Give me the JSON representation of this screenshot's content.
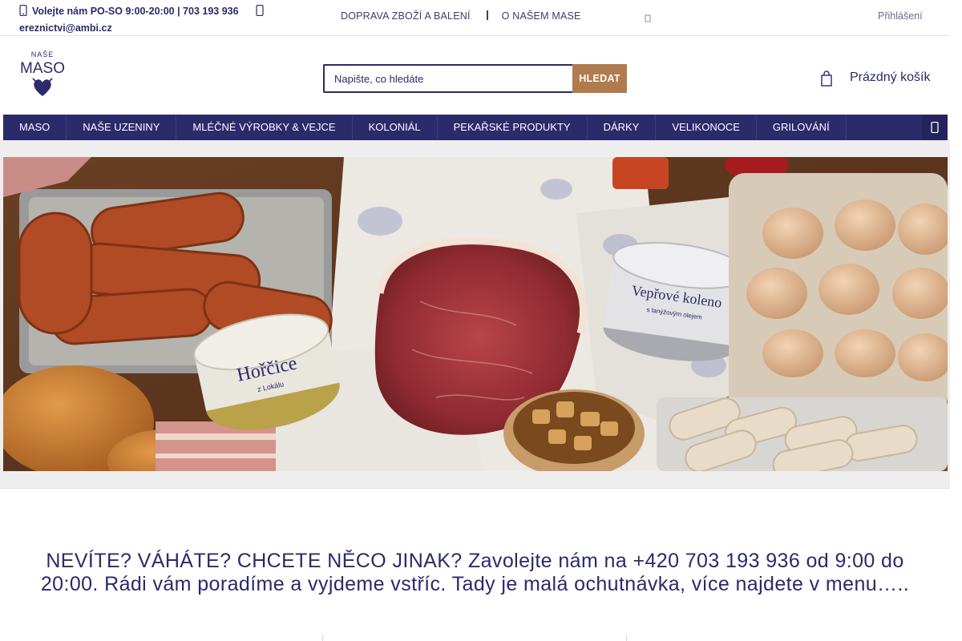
{
  "topbar": {
    "phone_text": "Volejte nám PO-SO 9:00-20:00 | 703 193 936",
    "email": "ereznictvi@ambi.cz",
    "links": [
      "DOPRAVA ZBOŽÍ A BALENÍ",
      "O NAŠEM MASE"
    ],
    "login": "Přihlášení"
  },
  "logo": {
    "line1": "NAŠE",
    "line2": "MASO"
  },
  "search": {
    "placeholder": "Napište, co hledáte",
    "button": "HLEDAT"
  },
  "cart": {
    "label": "Prázdný košík",
    "icon": "bag-icon"
  },
  "nav": {
    "items": [
      "MASO",
      "NAŠE UZENINY",
      "MLÉČNÉ VÝROBKY & VEJCE",
      "KOLONIÁL",
      "PEKAŘSKÉ PRODUKTY",
      "DÁRKY",
      "VELIKONOCE",
      "GRILOVÁNÍ"
    ],
    "more_icon": "more-icon"
  },
  "hero": {
    "jar1_title": "Hořčice",
    "jar1_sub": "z Lokálu",
    "jar2_title": "Vepřové koleno",
    "jar2_sub": "s lanýžovým olejem"
  },
  "promo": {
    "text": "NEVÍTE? VÁHÁTE? CHCETE NĚCO JINAK? Zavolejte nám na +420 703 193 936 od 9:00 do 20:00. Rádi vám poradíme a vyjdeme vstříc. Tady je malá ochutnávka, více najdete v menu….."
  },
  "colors": {
    "brand": "#2b2a6b",
    "accent": "#b07c4d"
  }
}
